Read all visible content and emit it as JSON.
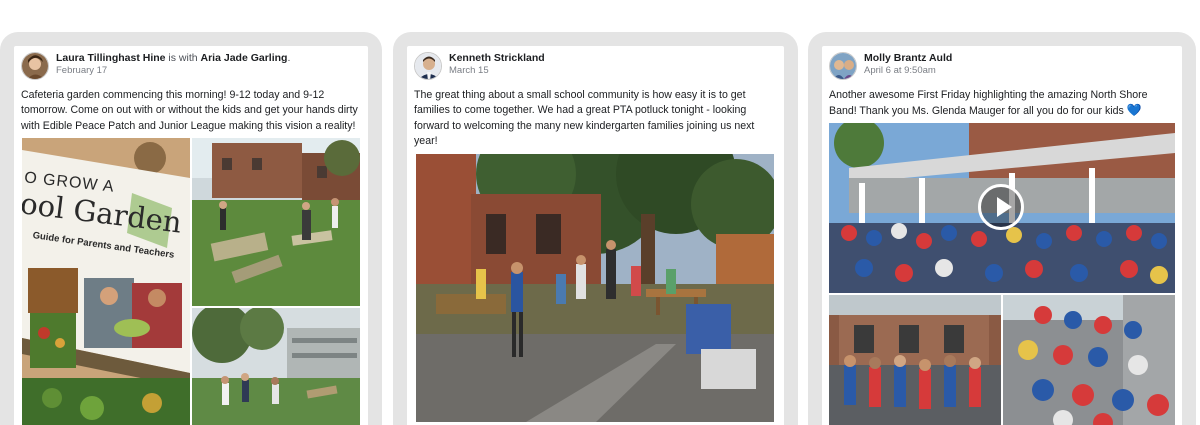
{
  "posts": [
    {
      "author": "Laura Tillinghast Hine",
      "with_text": " is with ",
      "tagged": "Aria Jade Garling",
      "tail": ".",
      "timestamp": "February 17",
      "text": "Cafeteria garden commencing this morning! 9-12 today and 9-12 tomorrow. Come on out with or without the kids and get your hands dirty with Edible Peace Patch and Junior League making this vision a reality!",
      "book_title_line1": "O GROW A",
      "book_title_line2": "ool Garden",
      "book_subtitle": "Guide for Parents and Teachers"
    },
    {
      "author": "Kenneth Strickland",
      "timestamp": "March 15",
      "text": "The great thing about a small school community is how easy it is to get families to come together. We had a great PTA potluck tonight - looking forward to welcoming the many new kindergarten families joining us next year!"
    },
    {
      "author": "Molly Brantz Auld",
      "timestamp": "April 6 at 9:50am",
      "text": "Another awesome First Friday highlighting the amazing North Shore Band! Thank you Ms. Glenda Mauger for all you do for our kids ",
      "emoji": "💙"
    }
  ]
}
